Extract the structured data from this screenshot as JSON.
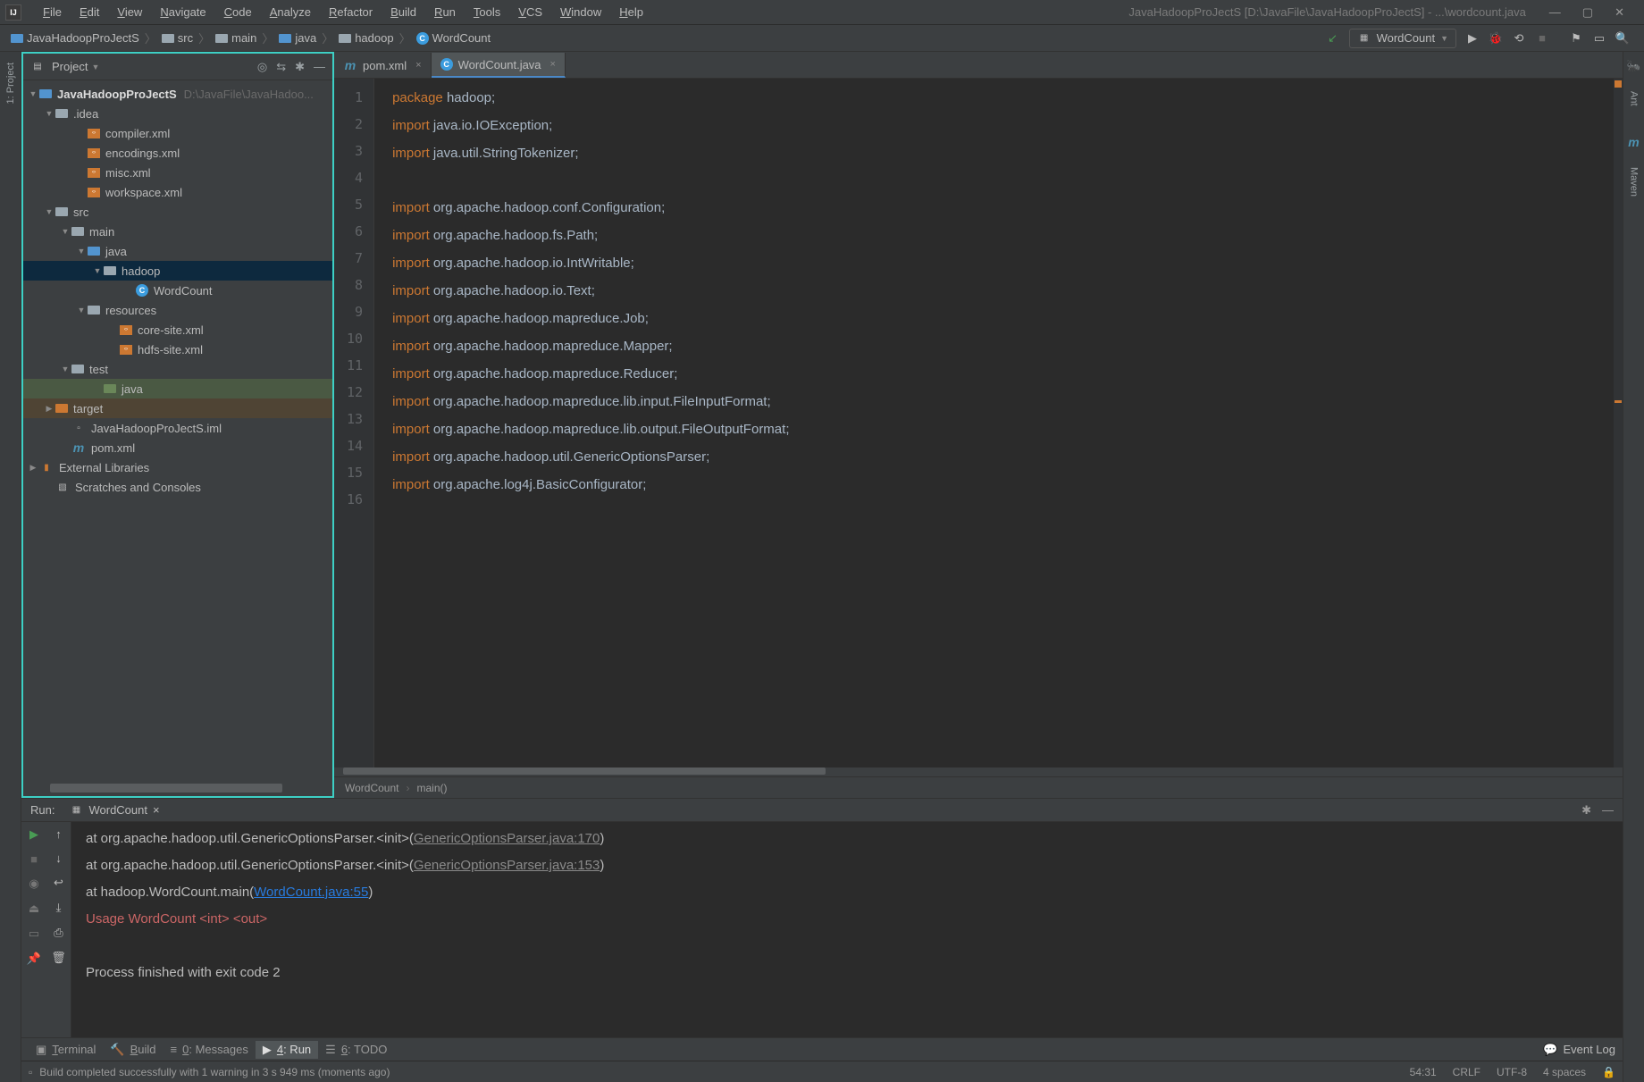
{
  "menu": [
    "File",
    "Edit",
    "View",
    "Navigate",
    "Code",
    "Analyze",
    "Refactor",
    "Build",
    "Run",
    "Tools",
    "VCS",
    "Window",
    "Help"
  ],
  "windowTitle": "JavaHadoopProJectS [D:\\JavaFile\\JavaHadoopProJectS] - ...\\wordcount.java",
  "breadcrumbs": [
    {
      "icon": "folder-blue",
      "label": "JavaHadoopProJectS"
    },
    {
      "icon": "folder",
      "label": "src"
    },
    {
      "icon": "folder",
      "label": "main"
    },
    {
      "icon": "folder-blue",
      "label": "java"
    },
    {
      "icon": "folder",
      "label": "hadoop"
    },
    {
      "icon": "class",
      "label": "WordCount"
    }
  ],
  "runConfig": "WordCount",
  "leftGutter": [
    "1: Project"
  ],
  "rightGutter": [
    "Ant",
    "Maven"
  ],
  "projectPanel": {
    "title": "Project",
    "root": {
      "label": "JavaHadoopProJectS",
      "meta": "D:\\JavaFile\\JavaHadoo..."
    },
    "idea": {
      "label": ".idea",
      "children": [
        "compiler.xml",
        "encodings.xml",
        "misc.xml",
        "workspace.xml"
      ]
    },
    "src": {
      "label": "src"
    },
    "main": {
      "label": "main"
    },
    "java": {
      "label": "java"
    },
    "hadoop": {
      "label": "hadoop"
    },
    "wordcount": {
      "label": "WordCount"
    },
    "resources": {
      "label": "resources",
      "children": [
        "core-site.xml",
        "hdfs-site.xml"
      ]
    },
    "test": {
      "label": "test"
    },
    "testjava": {
      "label": "java"
    },
    "target": {
      "label": "target"
    },
    "iml": {
      "label": "JavaHadoopProJectS.iml"
    },
    "pom": {
      "label": "pom.xml"
    },
    "extlib": {
      "label": "External Libraries"
    },
    "scratch": {
      "label": "Scratches and Consoles"
    }
  },
  "editorTabs": [
    {
      "icon": "m",
      "label": "pom.xml"
    },
    {
      "icon": "class",
      "label": "WordCount.java",
      "active": true
    }
  ],
  "code": {
    "lines": [
      {
        "n": 1,
        "t": [
          [
            "pkg",
            "package "
          ],
          [
            "id",
            "hadoop;"
          ]
        ]
      },
      {
        "n": 2,
        "t": [
          [
            "imp",
            "import "
          ],
          [
            "id",
            "java.io.IOException;"
          ]
        ]
      },
      {
        "n": 3,
        "t": [
          [
            "imp",
            "import "
          ],
          [
            "id",
            "java.util.StringTokenizer;"
          ]
        ]
      },
      {
        "n": 4,
        "t": []
      },
      {
        "n": 5,
        "t": [
          [
            "imp",
            "import "
          ],
          [
            "id",
            "org.apache.hadoop.conf.Configuration;"
          ]
        ]
      },
      {
        "n": 6,
        "t": [
          [
            "imp",
            "import "
          ],
          [
            "id",
            "org.apache.hadoop.fs.Path;"
          ]
        ]
      },
      {
        "n": 7,
        "t": [
          [
            "imp",
            "import "
          ],
          [
            "id",
            "org.apache.hadoop.io.IntWritable;"
          ]
        ]
      },
      {
        "n": 8,
        "t": [
          [
            "imp",
            "import "
          ],
          [
            "id",
            "org.apache.hadoop.io.Text;"
          ]
        ]
      },
      {
        "n": 9,
        "t": [
          [
            "imp",
            "import "
          ],
          [
            "id",
            "org.apache.hadoop.mapreduce.Job;"
          ]
        ]
      },
      {
        "n": 10,
        "t": [
          [
            "imp",
            "import "
          ],
          [
            "id",
            "org.apache.hadoop.mapreduce.Mapper;"
          ]
        ]
      },
      {
        "n": 11,
        "t": [
          [
            "imp",
            "import "
          ],
          [
            "id",
            "org.apache.hadoop.mapreduce.Reducer;"
          ]
        ]
      },
      {
        "n": 12,
        "t": [
          [
            "imp",
            "import "
          ],
          [
            "id",
            "org.apache.hadoop.mapreduce.lib.input.FileInputFormat;"
          ]
        ]
      },
      {
        "n": 13,
        "t": [
          [
            "imp",
            "import "
          ],
          [
            "id",
            "org.apache.hadoop.mapreduce.lib.output.FileOutputFormat;"
          ]
        ]
      },
      {
        "n": 14,
        "t": [
          [
            "imp",
            "import "
          ],
          [
            "id",
            "org.apache.hadoop.util.GenericOptionsParser;"
          ]
        ]
      },
      {
        "n": 15,
        "t": [
          [
            "imp",
            "import "
          ],
          [
            "id",
            "org.apache.log4j.BasicConfigurator;"
          ]
        ]
      },
      {
        "n": 16,
        "t": []
      }
    ]
  },
  "codeCrumbs": [
    "WordCount",
    "main()"
  ],
  "runPanel": {
    "title": "Run:",
    "tab": "WordCount",
    "output": [
      {
        "indent": true,
        "segs": [
          [
            "plain",
            "at org.apache.hadoop.util.GenericOptionsParser.<init>("
          ],
          [
            "u",
            "GenericOptionsParser.java:170"
          ],
          [
            "plain",
            ")"
          ]
        ]
      },
      {
        "indent": true,
        "segs": [
          [
            "plain",
            "at org.apache.hadoop.util.GenericOptionsParser.<init>("
          ],
          [
            "u",
            "GenericOptionsParser.java:153"
          ],
          [
            "plain",
            ")"
          ]
        ]
      },
      {
        "indent": true,
        "segs": [
          [
            "plain",
            "at hadoop.WordCount.main("
          ],
          [
            "link",
            "WordCount.java:55"
          ],
          [
            "plain",
            ")"
          ]
        ]
      },
      {
        "segs": [
          [
            "err",
            "Usage WordCount <int> <out>"
          ]
        ]
      },
      {
        "segs": [
          [
            "plain",
            ""
          ]
        ]
      },
      {
        "segs": [
          [
            "plain",
            "Process finished with exit code 2"
          ]
        ]
      }
    ]
  },
  "bottomTools": [
    {
      "icon": "terminal",
      "label": "Terminal"
    },
    {
      "icon": "hammer",
      "label": "Build"
    },
    {
      "icon": "msg",
      "label": "0: Messages"
    },
    {
      "icon": "play",
      "label": "4: Run",
      "active": true
    },
    {
      "icon": "todo",
      "label": "6: TODO"
    }
  ],
  "eventLog": "Event Log",
  "statusMsg": "Build completed successfully with 1 warning in 3 s 949 ms (moments ago)",
  "statusRight": [
    "54:31",
    "CRLF",
    "UTF-8",
    "4 spaces"
  ]
}
